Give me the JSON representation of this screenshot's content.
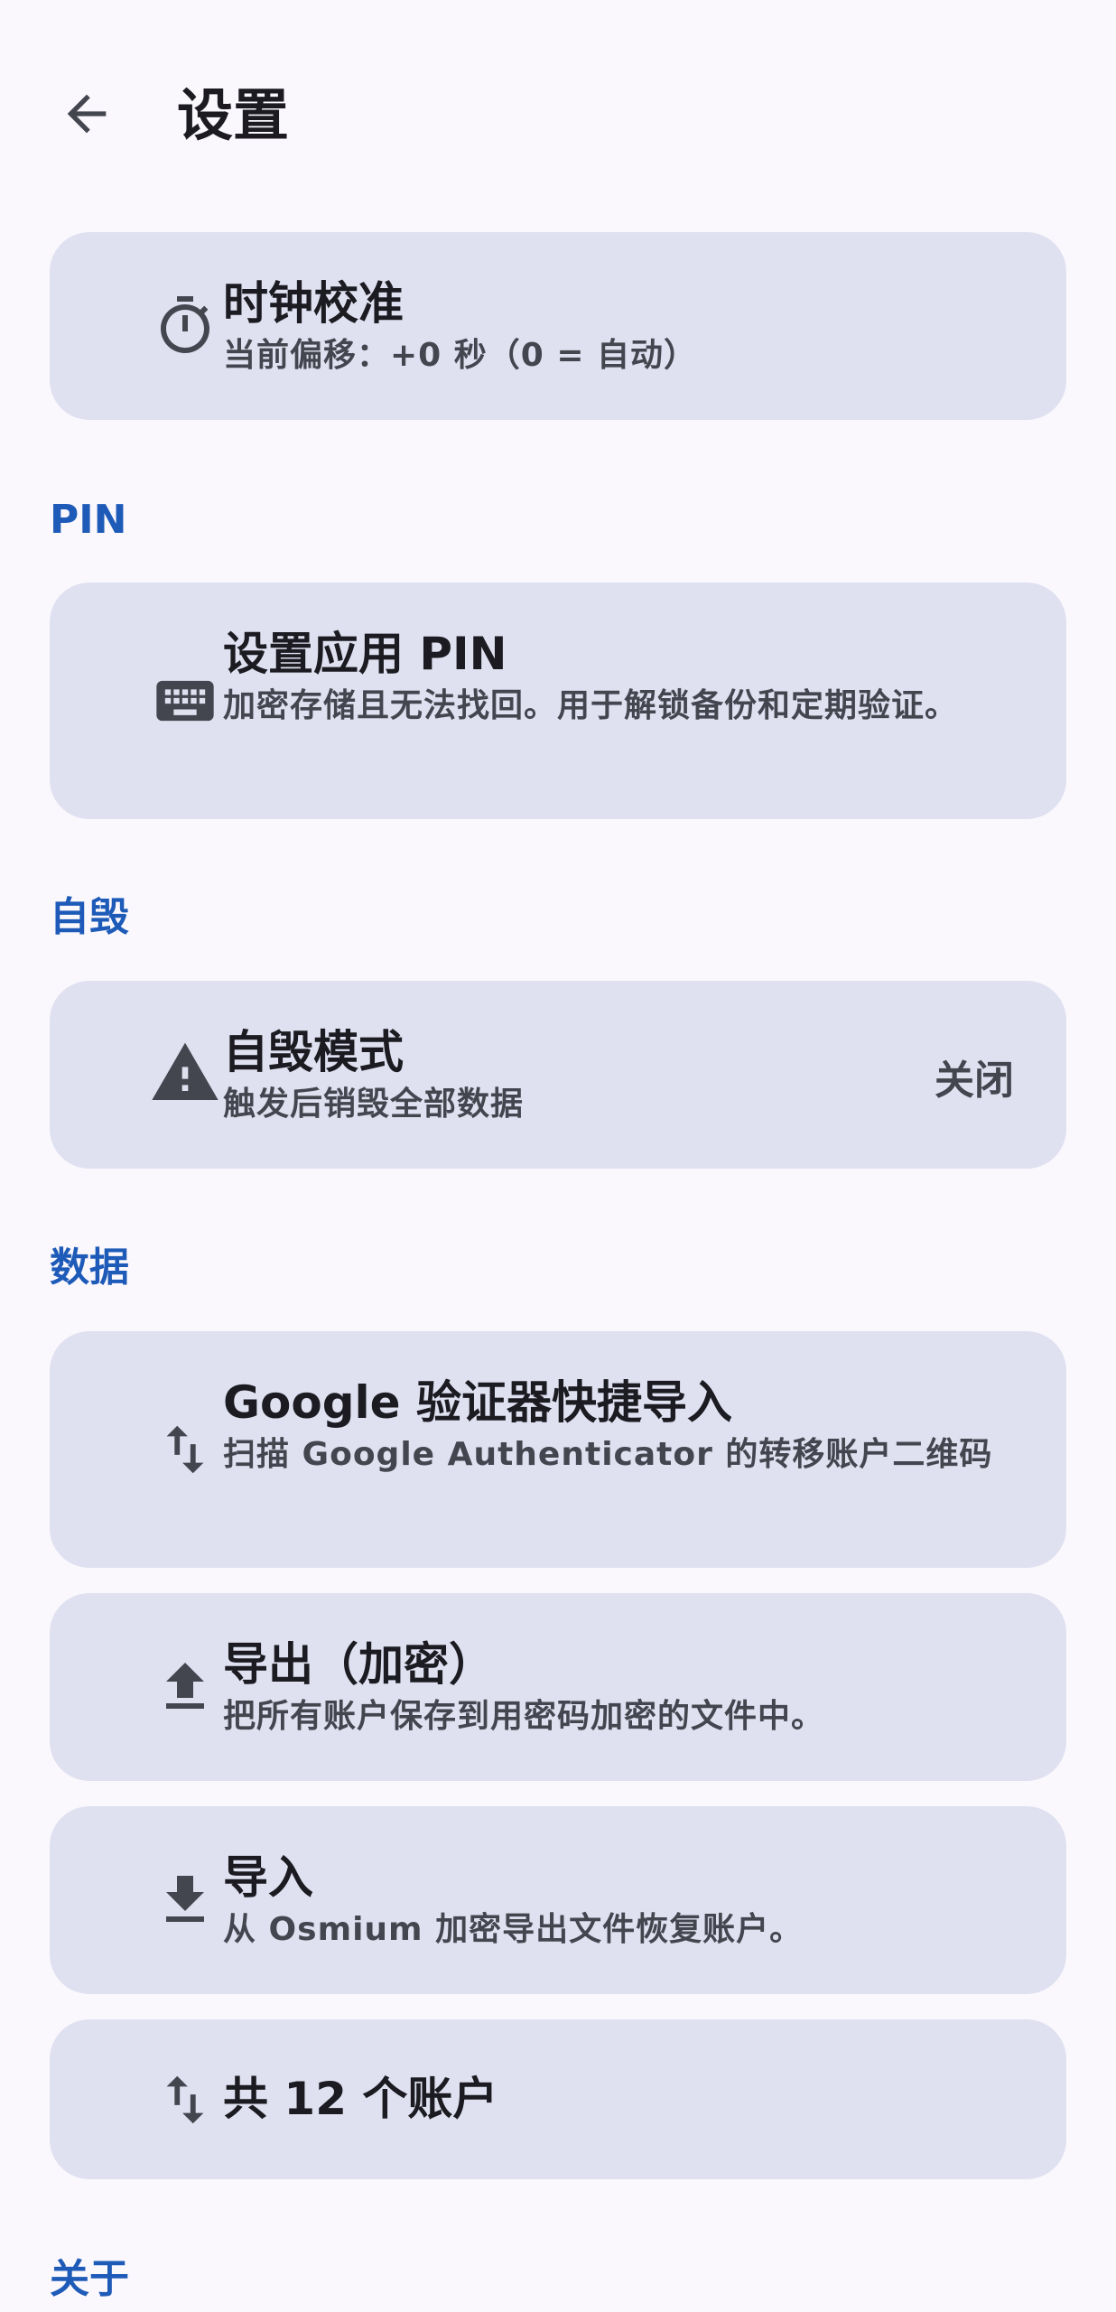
{
  "header": {
    "title": "设置",
    "back_icon": "arrow-back-icon"
  },
  "clock": {
    "icon": "timer-icon",
    "title": "时钟校准",
    "subtitle": "当前偏移：+0 秒（0 = 自动）"
  },
  "pin": {
    "section": "PIN",
    "icon": "keyboard-icon",
    "title": "设置应用 PIN",
    "subtitle": "加密存储且无法找回。用于解锁备份和定期验证。"
  },
  "self_destruct": {
    "section": "自毁",
    "icon": "warning-icon",
    "title": "自毁模式",
    "subtitle": "触发后销毁全部数据",
    "state": "关闭"
  },
  "data": {
    "section": "数据",
    "google_import": {
      "icon": "swap-vert-icon",
      "title": "Google 验证器快捷导入",
      "subtitle": "扫描 Google Authenticator 的转移账户二维码"
    },
    "export": {
      "icon": "upload-icon",
      "title": "导出（加密）",
      "subtitle": "把所有账户保存到用密码加密的文件中。"
    },
    "import": {
      "icon": "download-icon",
      "title": "导入",
      "subtitle": "从 Osmium 加密导出文件恢复账户。"
    },
    "accounts": {
      "icon": "swap-vert-icon",
      "title": "共 12 个账户"
    }
  },
  "about": {
    "section": "关于"
  },
  "colors": {
    "background": "#fbf8fd",
    "card": "#dfe1f1",
    "section_header": "#1e5bb8",
    "icon": "#44464f"
  }
}
